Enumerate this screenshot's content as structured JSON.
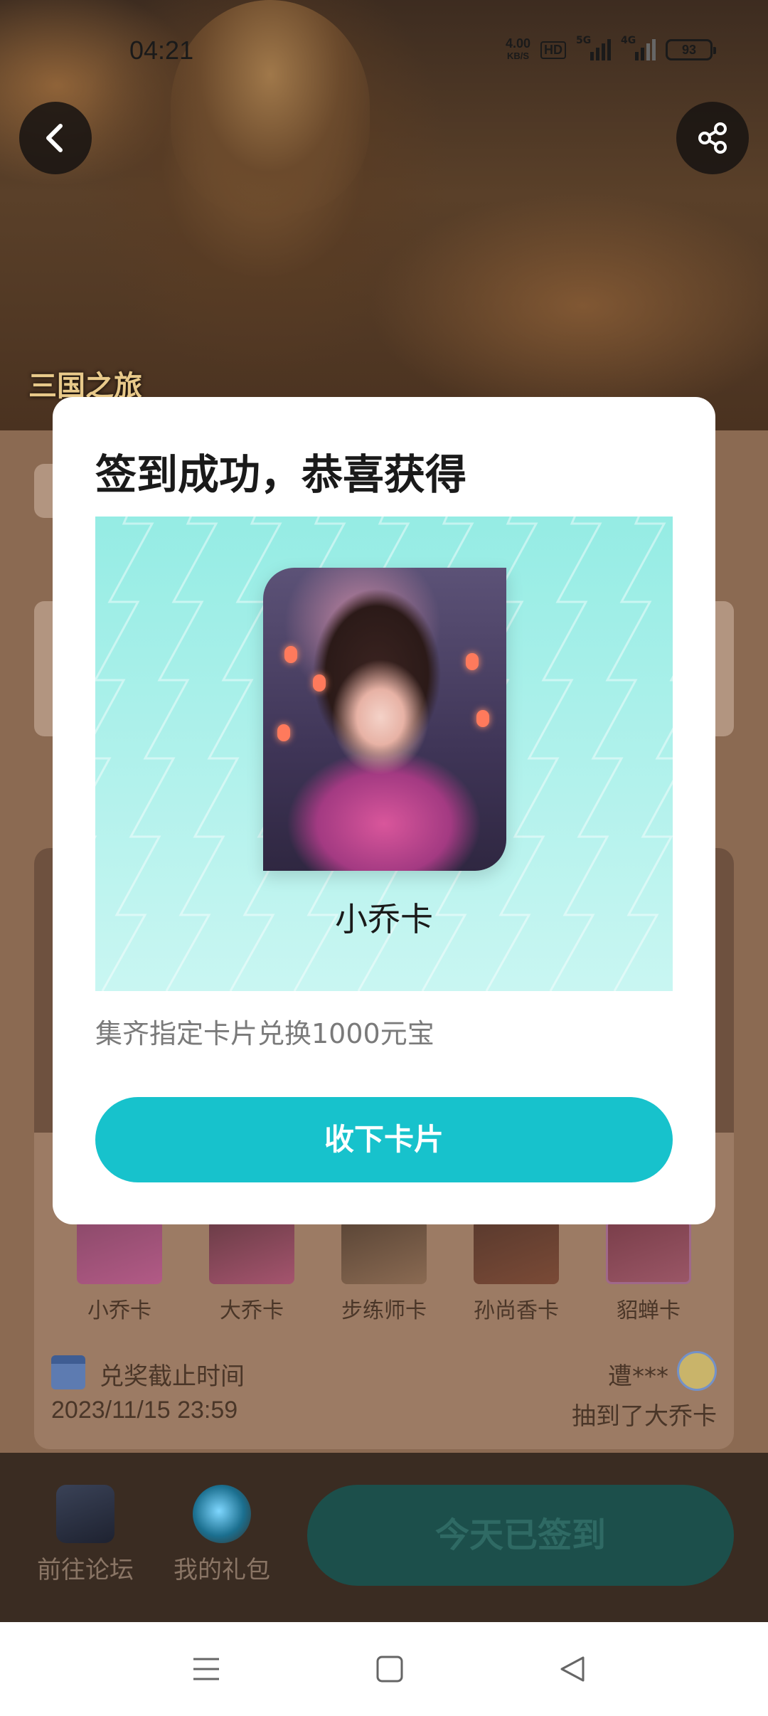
{
  "status_bar": {
    "time": "04:21",
    "net_speed_value": "4.00",
    "net_speed_unit": "KB/S",
    "hd_label": "HD",
    "signal_1_label": "5G",
    "signal_2_label": "4G",
    "battery": "93"
  },
  "hero": {
    "logo_text": "三国之旅"
  },
  "nav": {
    "back_icon": "chevron-left-icon",
    "share_icon": "share-icon"
  },
  "card_collection": {
    "cards": [
      {
        "name": "小乔卡"
      },
      {
        "name": "大乔卡"
      },
      {
        "name": "步练师卡"
      },
      {
        "name": "孙尚香卡"
      },
      {
        "name": "貂蝉卡"
      }
    ],
    "deadline_label": "兑奖截止时间",
    "deadline_value": "2023/11/15 23:59",
    "winner_name": "遭***",
    "winner_desc": "抽到了大乔卡"
  },
  "bottom_bar": {
    "forum_label": "前往论坛",
    "gift_label": "我的礼包",
    "signed_label": "今天已签到"
  },
  "dialog": {
    "title": "签到成功，恭喜获得",
    "card_name": "小乔卡",
    "description": "集齐指定卡片兑换1000元宝",
    "accept_label": "收下卡片"
  },
  "system_nav": {
    "menu_icon": "menu-icon",
    "home_icon": "home-square-icon",
    "back_icon": "back-triangle-icon"
  },
  "colors": {
    "accent": "#17c2cc",
    "overlay_page": "#8b6a52",
    "dialog_bg": "#ffffff"
  }
}
